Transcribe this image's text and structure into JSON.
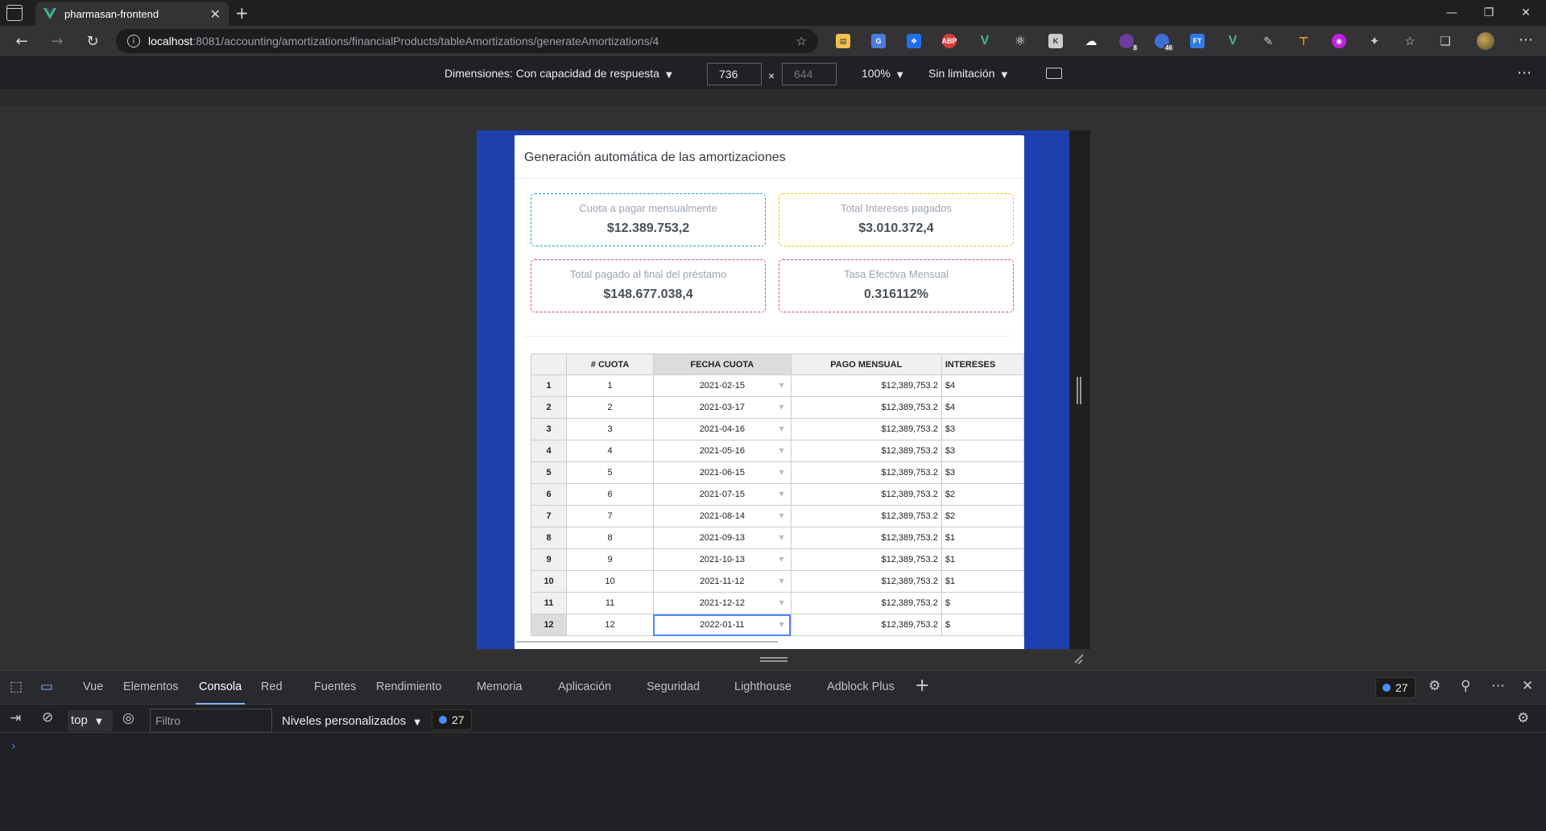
{
  "browser": {
    "tab_title": "pharmasan-frontend",
    "url_host": "localhost",
    "url_path": ":8081/accounting/amortizations/financialProducts/tableAmortizations/generateAmortizations/4"
  },
  "responsive_toolbar": {
    "dimensions_label": "Dimensiones: Con capacidad de respuesta",
    "width": "736",
    "height": "644",
    "separator": "×",
    "zoom": "100%",
    "throttle": "Sin limitación"
  },
  "page": {
    "card_title": "Generación automática de las amortizaciones",
    "stats": [
      {
        "label": "Cuota a pagar mensualmente",
        "value": "$12.389.753,2",
        "border_color": "#17a2b8"
      },
      {
        "label": "Total Intereses pagados",
        "value": "$3.010.372,4",
        "border_color": "#ffc107"
      },
      {
        "label": "Total pagado al final del préstamo",
        "value": "$148.677.038,4",
        "border_color": "#e83e8c"
      },
      {
        "label": "Tasa Efectiva Mensual",
        "value": "0.316112%",
        "border_color": "#e83e8c"
      }
    ],
    "table": {
      "columns": [
        "# CUOTA",
        "FECHA CUOTA",
        "PAGO MENSUAL",
        "INTERESES"
      ],
      "rows": [
        {
          "row": "1",
          "cuota": "1",
          "fecha": "2021-02-15",
          "pago": "$12,389,753.2",
          "interes": "$4"
        },
        {
          "row": "2",
          "cuota": "2",
          "fecha": "2021-03-17",
          "pago": "$12,389,753.2",
          "interes": "$4"
        },
        {
          "row": "3",
          "cuota": "3",
          "fecha": "2021-04-16",
          "pago": "$12,389,753.2",
          "interes": "$3"
        },
        {
          "row": "4",
          "cuota": "4",
          "fecha": "2021-05-16",
          "pago": "$12,389,753.2",
          "interes": "$3"
        },
        {
          "row": "5",
          "cuota": "5",
          "fecha": "2021-06-15",
          "pago": "$12,389,753.2",
          "interes": "$3"
        },
        {
          "row": "6",
          "cuota": "6",
          "fecha": "2021-07-15",
          "pago": "$12,389,753.2",
          "interes": "$2"
        },
        {
          "row": "7",
          "cuota": "7",
          "fecha": "2021-08-14",
          "pago": "$12,389,753.2",
          "interes": "$2"
        },
        {
          "row": "8",
          "cuota": "8",
          "fecha": "2021-09-13",
          "pago": "$12,389,753.2",
          "interes": "$1"
        },
        {
          "row": "9",
          "cuota": "9",
          "fecha": "2021-10-13",
          "pago": "$12,389,753.2",
          "interes": "$1"
        },
        {
          "row": "10",
          "cuota": "10",
          "fecha": "2021-11-12",
          "pago": "$12,389,753.2",
          "interes": "$1"
        },
        {
          "row": "11",
          "cuota": "11",
          "fecha": "2021-12-12",
          "pago": "$12,389,753.2",
          "interes": "$"
        },
        {
          "row": "12",
          "cuota": "12",
          "fecha": "2022-01-11",
          "pago": "$12,389,753.2",
          "interes": "$"
        }
      ]
    }
  },
  "devtools": {
    "tabs": [
      "Vue",
      "Elementos",
      "Consola",
      "Red",
      "Fuentes",
      "Rendimiento",
      "Memoria",
      "Aplicación",
      "Seguridad",
      "Lighthouse",
      "Adblock Plus"
    ],
    "active_tab": "Consola",
    "message_count": "27",
    "context": "top",
    "filter_placeholder": "Filtro",
    "levels": "Niveles personalizados"
  },
  "colors": {
    "device_background": "#1e40af",
    "selection_outline": "#4b89ff"
  }
}
